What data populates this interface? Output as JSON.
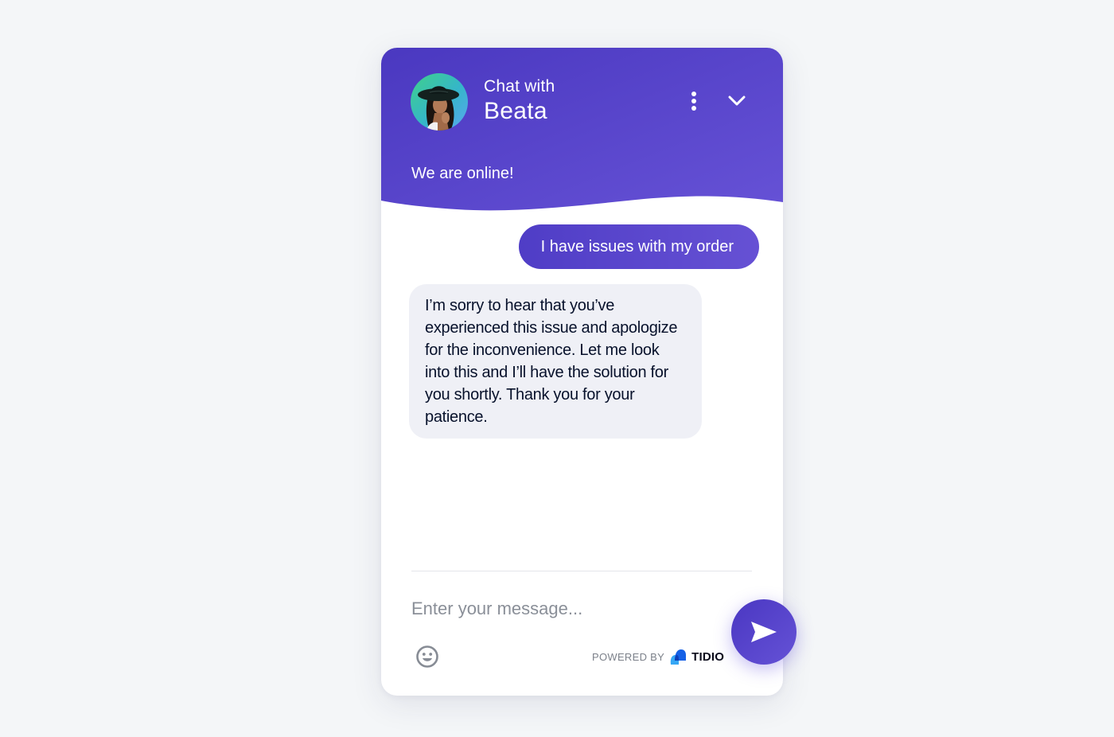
{
  "colors": {
    "brand_primary": "#5240c8",
    "brand_secondary": "#6652d6",
    "page_background": "#f4f6f8",
    "bot_bubble": "#eff0f6",
    "text_dark": "#07112b"
  },
  "header": {
    "subtitle": "Chat with",
    "agent_name": "Beata",
    "status": "We are online!",
    "avatar_alt": "Beata avatar",
    "icons": {
      "menu": "more-vertical-icon",
      "collapse": "chevron-down-icon"
    }
  },
  "messages": [
    {
      "sender": "user",
      "text": "I have issues with my order"
    },
    {
      "sender": "agent",
      "text": "I’m sorry to hear that you’ve experienced this issue and apologize for the inconvenience. Let me look into this and I’ll have the solution for you shortly. Thank you for your patience."
    }
  ],
  "composer": {
    "placeholder": "Enter your message...",
    "value": "",
    "emoji_icon": "smiley-icon",
    "send_icon": "send-icon"
  },
  "footer": {
    "powered_by": "POWERED BY",
    "brand": "TIDIO"
  }
}
